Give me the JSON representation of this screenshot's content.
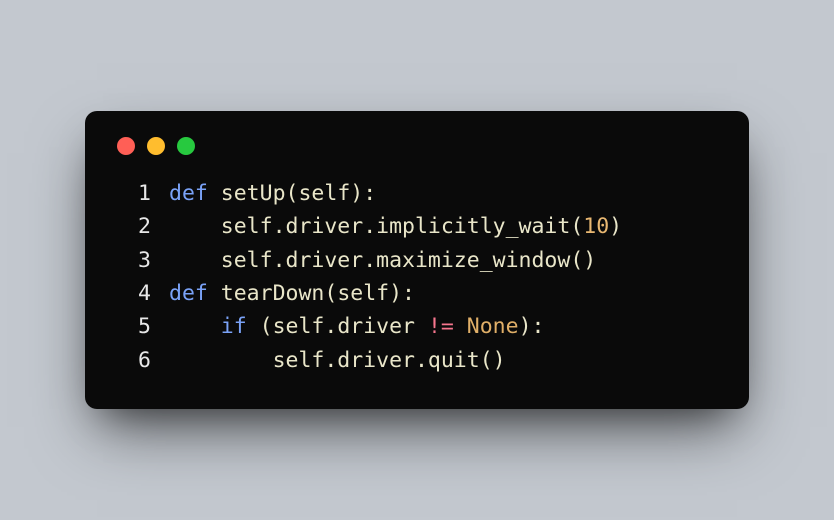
{
  "window": {
    "buttons": [
      "close",
      "minimize",
      "zoom"
    ]
  },
  "code": {
    "lines": [
      {
        "num": "1",
        "tokens": [
          {
            "cls": "keyword",
            "t": "def"
          },
          {
            "cls": "space",
            "t": " "
          },
          {
            "cls": "funcname",
            "t": "setUp"
          },
          {
            "cls": "paren",
            "t": "("
          },
          {
            "cls": "param",
            "t": "self"
          },
          {
            "cls": "paren",
            "t": ")"
          },
          {
            "cls": "colon",
            "t": ":"
          }
        ]
      },
      {
        "num": "2",
        "tokens": [
          {
            "cls": "space",
            "t": "    "
          },
          {
            "cls": "self",
            "t": "self"
          },
          {
            "cls": "dot",
            "t": "."
          },
          {
            "cls": "attr",
            "t": "driver"
          },
          {
            "cls": "dot",
            "t": "."
          },
          {
            "cls": "callattr",
            "t": "implicitly_wait"
          },
          {
            "cls": "paren",
            "t": "("
          },
          {
            "cls": "number",
            "t": "10"
          },
          {
            "cls": "paren",
            "t": ")"
          }
        ]
      },
      {
        "num": "3",
        "tokens": [
          {
            "cls": "space",
            "t": "    "
          },
          {
            "cls": "self",
            "t": "self"
          },
          {
            "cls": "dot",
            "t": "."
          },
          {
            "cls": "attr",
            "t": "driver"
          },
          {
            "cls": "dot",
            "t": "."
          },
          {
            "cls": "callattr",
            "t": "maximize_window"
          },
          {
            "cls": "paren",
            "t": "("
          },
          {
            "cls": "paren",
            "t": ")"
          }
        ]
      },
      {
        "num": "4",
        "tokens": [
          {
            "cls": "keyword",
            "t": "def"
          },
          {
            "cls": "space",
            "t": " "
          },
          {
            "cls": "funcname",
            "t": "tearDown"
          },
          {
            "cls": "paren",
            "t": "("
          },
          {
            "cls": "param",
            "t": "self"
          },
          {
            "cls": "paren",
            "t": ")"
          },
          {
            "cls": "colon",
            "t": ":"
          }
        ]
      },
      {
        "num": "5",
        "tokens": [
          {
            "cls": "space",
            "t": "    "
          },
          {
            "cls": "keyword",
            "t": "if"
          },
          {
            "cls": "space",
            "t": " "
          },
          {
            "cls": "paren",
            "t": "("
          },
          {
            "cls": "self",
            "t": "self"
          },
          {
            "cls": "dot",
            "t": "."
          },
          {
            "cls": "attr",
            "t": "driver"
          },
          {
            "cls": "space",
            "t": " "
          },
          {
            "cls": "op",
            "t": "!="
          },
          {
            "cls": "space",
            "t": " "
          },
          {
            "cls": "const",
            "t": "None"
          },
          {
            "cls": "paren",
            "t": ")"
          },
          {
            "cls": "colon",
            "t": ":"
          }
        ]
      },
      {
        "num": "6",
        "tokens": [
          {
            "cls": "space",
            "t": "        "
          },
          {
            "cls": "self",
            "t": "self"
          },
          {
            "cls": "dot",
            "t": "."
          },
          {
            "cls": "attr",
            "t": "driver"
          },
          {
            "cls": "dot",
            "t": "."
          },
          {
            "cls": "callattr",
            "t": "quit"
          },
          {
            "cls": "paren",
            "t": "("
          },
          {
            "cls": "paren",
            "t": ")"
          }
        ]
      }
    ]
  }
}
